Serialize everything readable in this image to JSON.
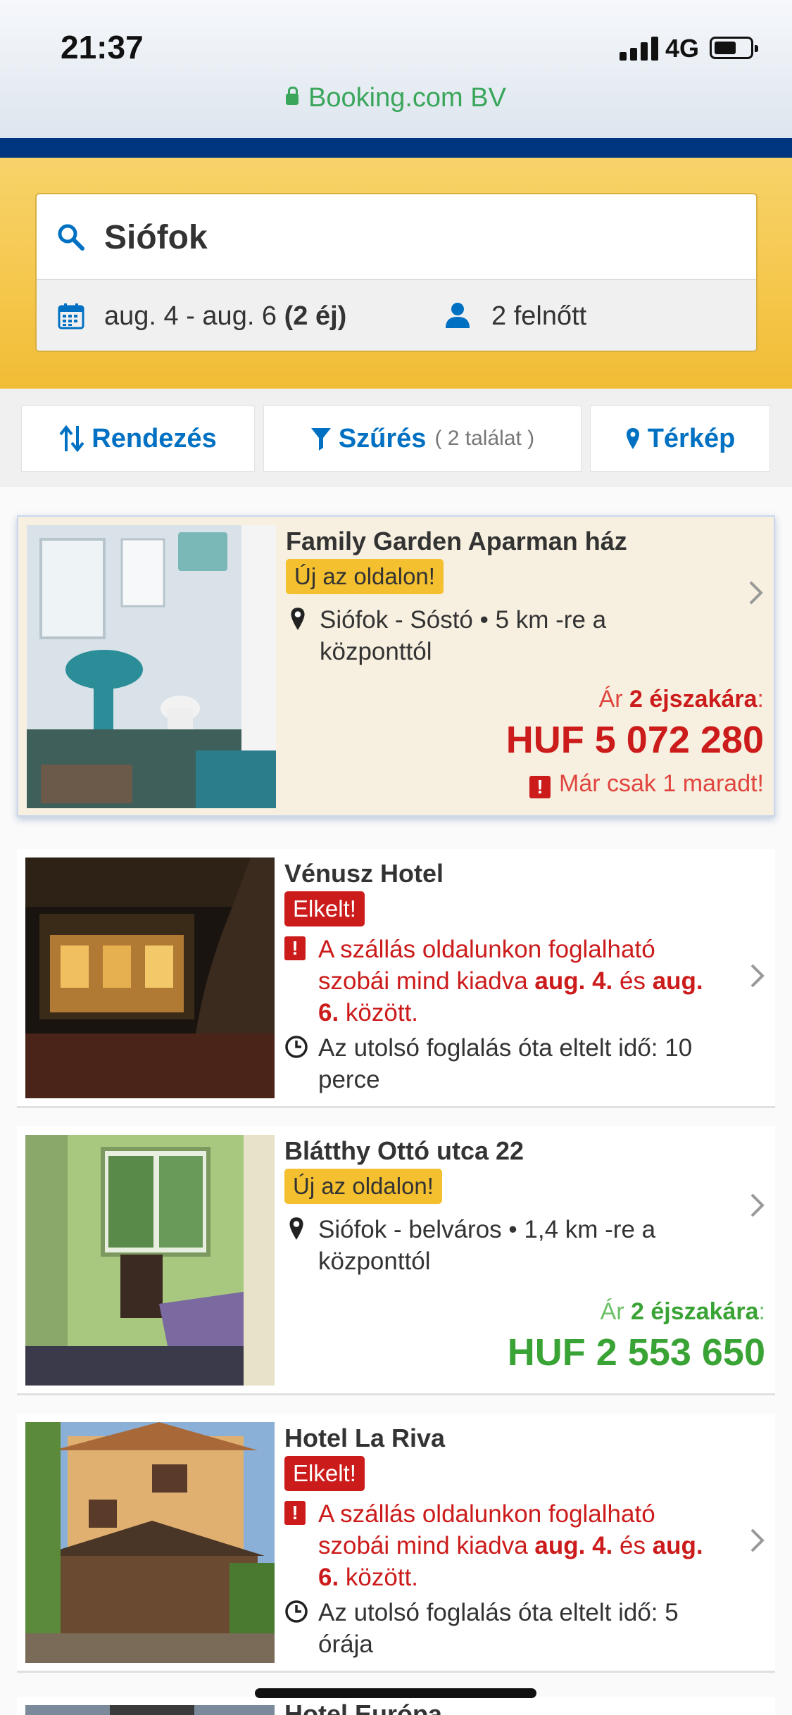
{
  "status_bar": {
    "time": "21:37",
    "network": "4G"
  },
  "browser": {
    "site": "Booking.com BV"
  },
  "search": {
    "destination": "Siófok",
    "dates": "aug. 4 - aug. 6",
    "nights": "(2 éj)",
    "guests": "2 felnőtt"
  },
  "filters": {
    "sort_label": "Rendezés",
    "filter_label": "Szűrés",
    "filter_count": "( 2 találat )",
    "map_label": "Térkép"
  },
  "listings": [
    {
      "name": "Family Garden Aparman ház",
      "badge": "Új az oldalon!",
      "location": "Siófok - Sóstó • 5 km -re a központtól",
      "price_prefix": "Ár ",
      "price_nights": "2 éjszakára",
      "price_suffix": ":",
      "price": "HUF 5 072 280",
      "remaining": "Már csak 1 maradt!",
      "price_color": "#cc1b1b"
    },
    {
      "name": "Vénusz Hotel",
      "badge": "Elkelt!",
      "soldout_1": "A szállás oldalunkon foglalható szobái mind kiadva ",
      "soldout_d1": "aug. 4.",
      "soldout_2": " és ",
      "soldout_d2": "aug. 6.",
      "soldout_3": " között.",
      "last_booking": "Az utolsó foglalás óta eltelt idő: 10 perce"
    },
    {
      "name": "Blátthy Ottó utca 22",
      "badge": "Új az oldalon!",
      "location": "Siófok - belváros • 1,4 km -re a központtól",
      "price_prefix": "Ár ",
      "price_nights": "2 éjszakára",
      "price_suffix": ":",
      "price": "HUF 2 553 650",
      "price_color": "#3aa335"
    },
    {
      "name": "Hotel La Riva",
      "badge": "Elkelt!",
      "soldout_1": "A szállás oldalunkon foglalható szobái mind kiadva ",
      "soldout_d1": "aug. 4.",
      "soldout_2": " és ",
      "soldout_d2": "aug. 6.",
      "soldout_3": " között.",
      "last_booking": "Az utolsó foglalás óta eltelt idő: 5 órája"
    },
    {
      "name": "Hotel Európa"
    }
  ],
  "colors": {
    "brand_blue": "#003580",
    "link_blue": "#0071c2",
    "sold_red": "#cc1b1b",
    "badge_yellow": "#f4c030"
  }
}
